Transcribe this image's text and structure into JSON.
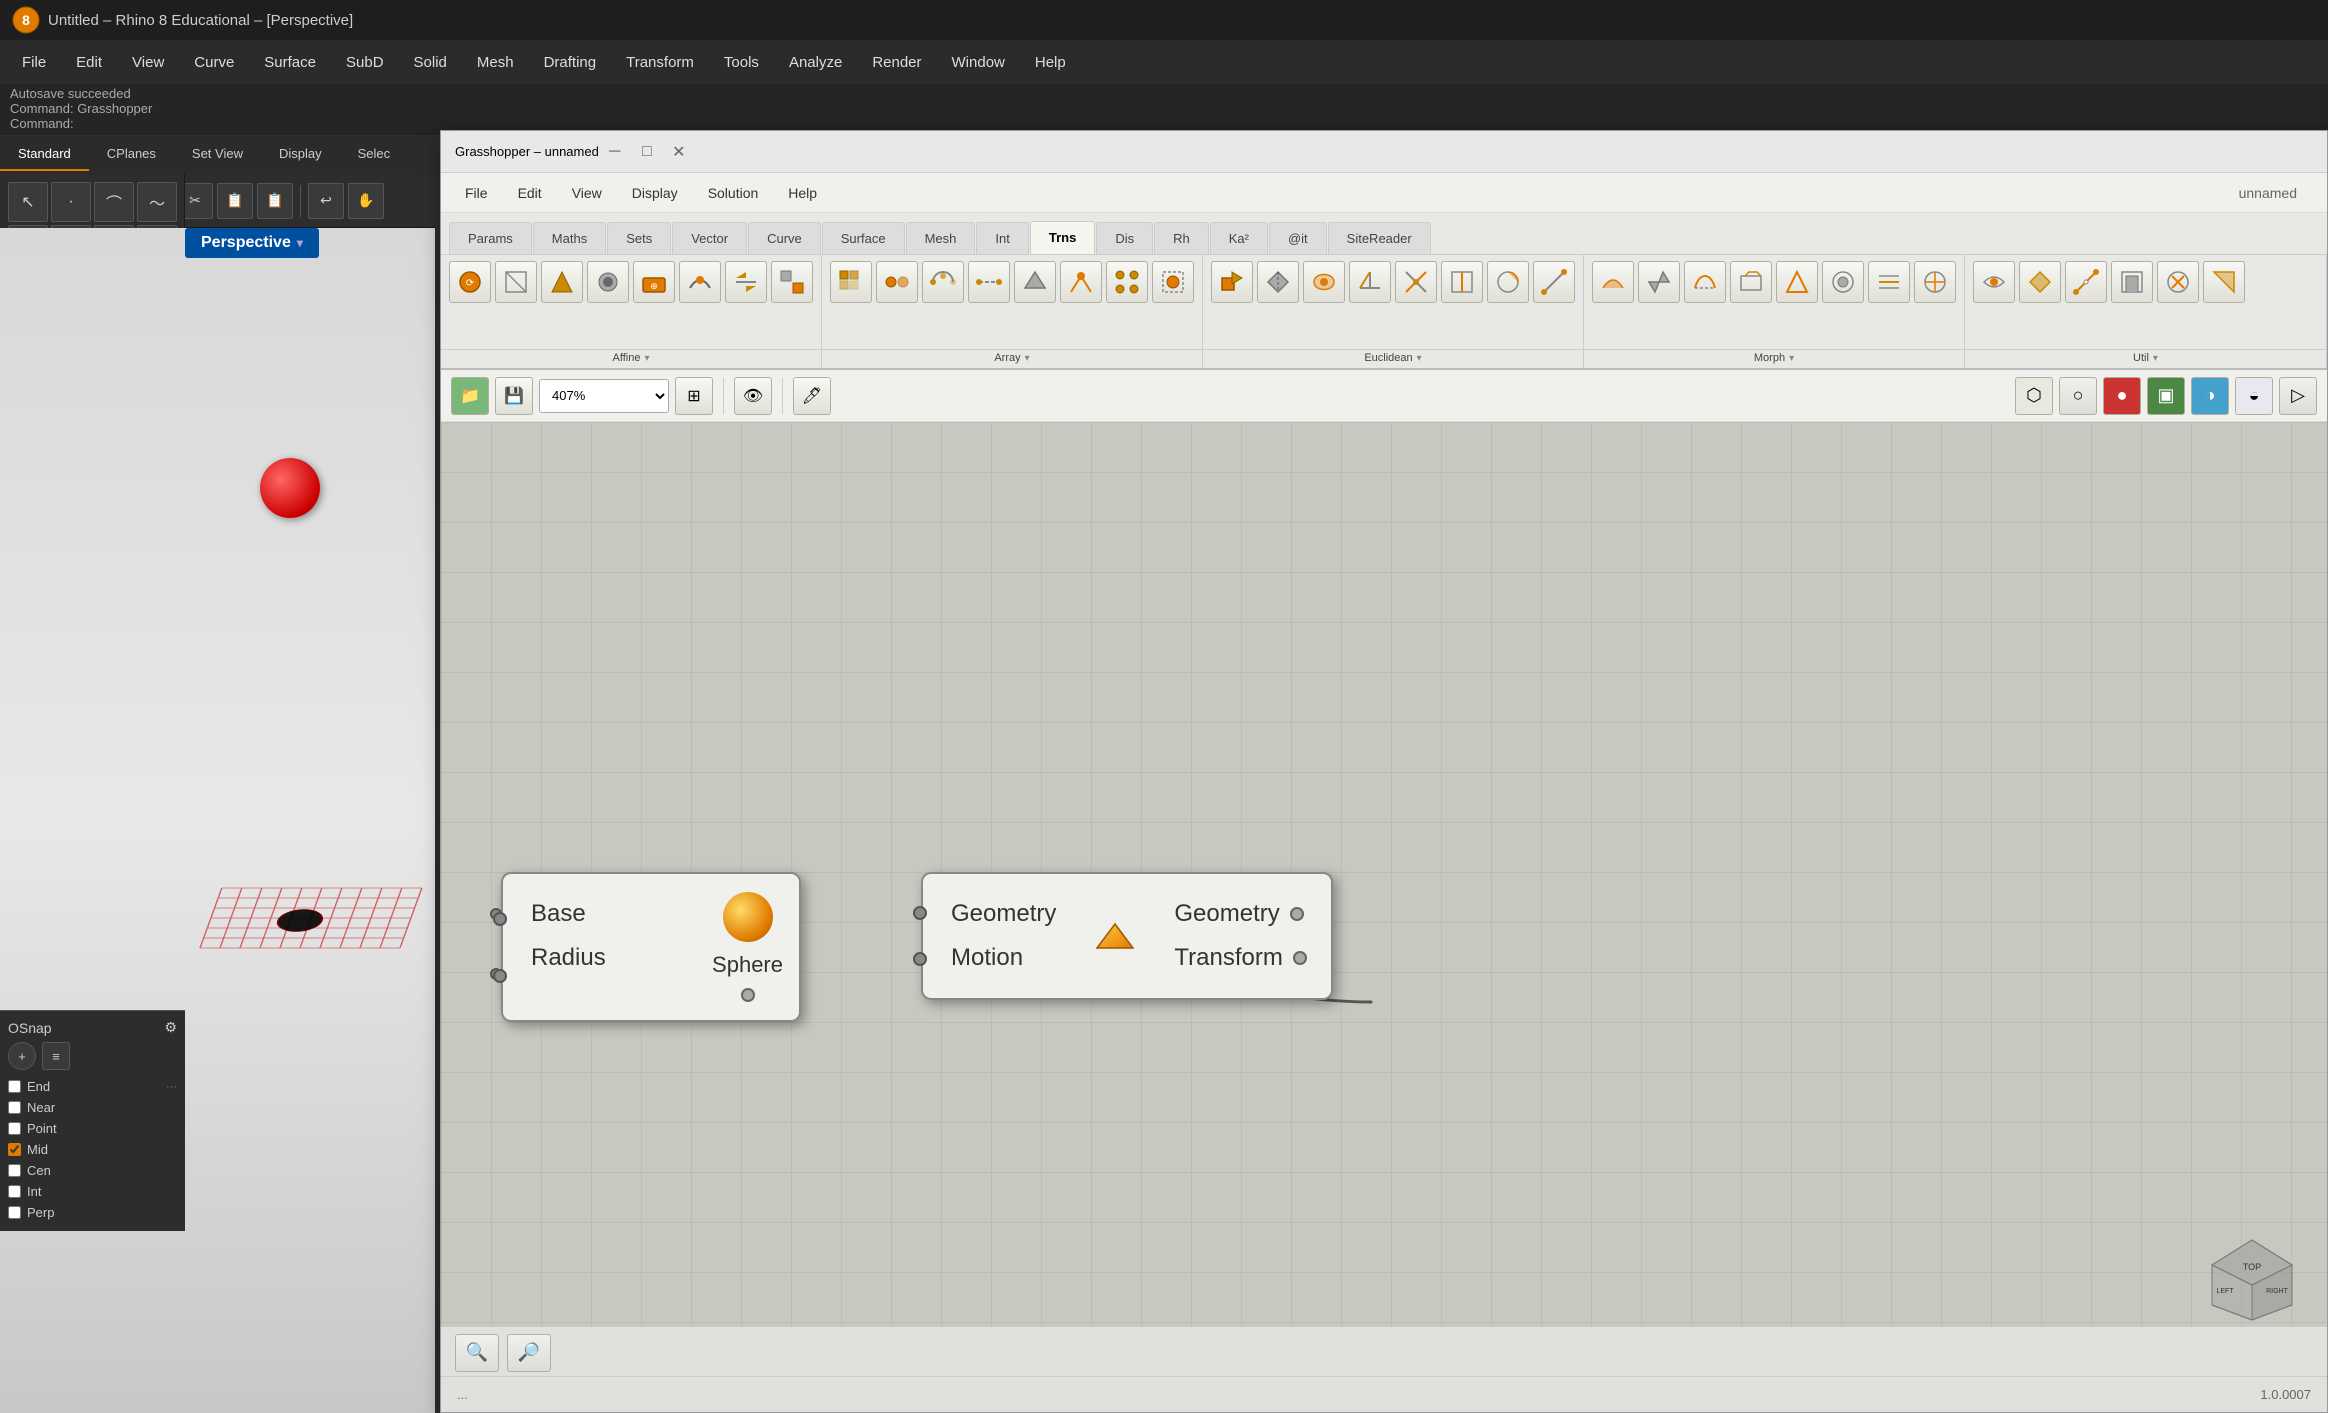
{
  "rhino": {
    "title": "Untitled – Rhino 8 Educational – [Perspective]",
    "status_lines": [
      "Autosave succeeded",
      "Command: Grasshopper",
      "Command:"
    ],
    "menu_items": [
      "File",
      "Edit",
      "View",
      "Curve",
      "Surface",
      "SubD",
      "Solid",
      "Mesh",
      "Drafting",
      "Transform",
      "Tools",
      "Analyze",
      "Render",
      "Window",
      "Help"
    ],
    "toolbar_tabs": [
      "Standard",
      "CPlanes",
      "Set View",
      "Display",
      "Selec"
    ],
    "viewport_label": "Perspective",
    "toolbar_icons": [
      "□",
      "📁",
      "💾",
      "🖨",
      "📋",
      "✂",
      "📋",
      "📋",
      "↩",
      "✋"
    ]
  },
  "osnap": {
    "title": "OSnap",
    "items": [
      {
        "label": "End",
        "checked": false
      },
      {
        "label": "Near",
        "checked": false
      },
      {
        "label": "Point",
        "checked": false
      },
      {
        "label": "Mid",
        "checked": true
      },
      {
        "label": "Cen",
        "checked": false
      },
      {
        "label": "Int",
        "checked": false
      },
      {
        "label": "Perp",
        "checked": false
      }
    ]
  },
  "grasshopper": {
    "title": "Grasshopper – unnamed",
    "unnamed_label": "unnamed",
    "menu_items": [
      "File",
      "Edit",
      "View",
      "Display",
      "Solution",
      "Help"
    ],
    "tabs": [
      "Params",
      "Maths",
      "Sets",
      "Vector",
      "Curve",
      "Surface",
      "Mesh",
      "Int",
      "Trns",
      "Dis",
      "Rh",
      "Ka²",
      "@it",
      "SiteReader"
    ],
    "active_tab": "Trns",
    "ribbon_groups": [
      {
        "label": "Affine",
        "icon_count": 8
      },
      {
        "label": "Array",
        "icon_count": 8
      },
      {
        "label": "Euclidean",
        "icon_count": 8
      },
      {
        "label": "Morph",
        "icon_count": 8
      },
      {
        "label": "Util",
        "icon_count": 6
      }
    ],
    "zoom": "407%",
    "canvas": {
      "sphere_node": {
        "inputs": [
          "Base",
          "Radius"
        ],
        "output": "Sphere",
        "has_sphere_icon": true
      },
      "transform_node": {
        "inputs": [
          "Geometry",
          "Motion"
        ],
        "outputs": [
          "Geometry",
          "Transform"
        ]
      }
    },
    "bottom_left": "...",
    "bottom_right": "1.0.0007"
  }
}
